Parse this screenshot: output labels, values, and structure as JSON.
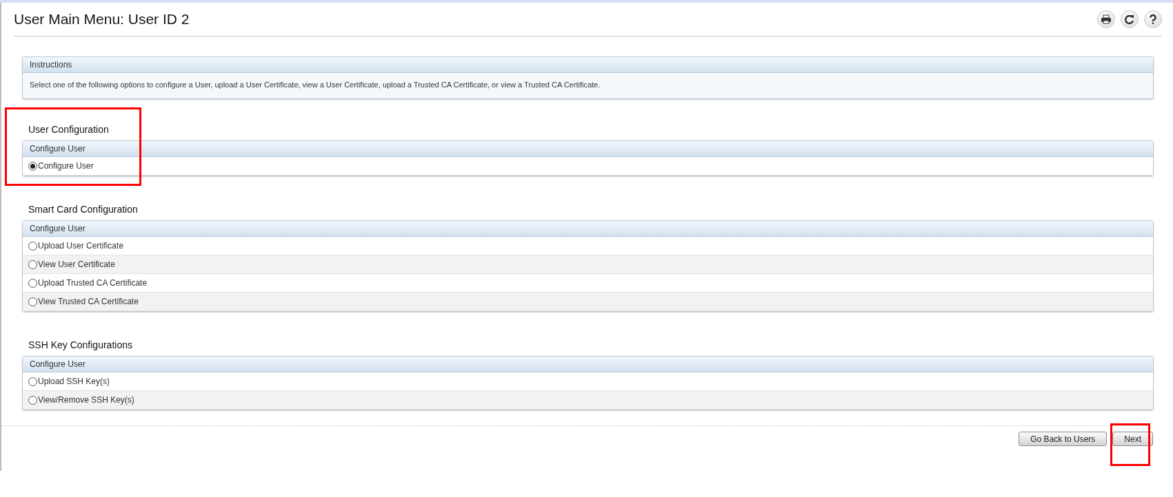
{
  "page": {
    "title": "User Main Menu: User ID 2"
  },
  "toolbar": [
    {
      "kind": "print"
    },
    {
      "kind": "refresh"
    },
    {
      "kind": "help"
    }
  ],
  "instructions": {
    "header": "Instructions",
    "text": "Select one of the following options to configure a User, upload a User Certificate, view a User Certificate, upload a Trusted CA Certificate, or view a Trusted CA Certificate."
  },
  "sections": [
    {
      "heading": "User Configuration",
      "table_header": "Configure User",
      "highlighted": true,
      "options": [
        {
          "label": "Configure User",
          "selected": true
        }
      ]
    },
    {
      "heading": "Smart Card Configuration",
      "table_header": "Configure User",
      "highlighted": false,
      "options": [
        {
          "label": "Upload User Certificate",
          "selected": false
        },
        {
          "label": "View User Certificate",
          "selected": false
        },
        {
          "label": "Upload Trusted CA Certificate",
          "selected": false
        },
        {
          "label": "View Trusted CA Certificate",
          "selected": false
        }
      ]
    },
    {
      "heading": "SSH Key Configurations",
      "table_header": "Configure User",
      "highlighted": false,
      "options": [
        {
          "label": "Upload SSH Key(s)",
          "selected": false
        },
        {
          "label": "View/Remove SSH Key(s)",
          "selected": false
        }
      ]
    }
  ],
  "buttons": [
    {
      "label": "Go Back to Users",
      "highlighted": false
    },
    {
      "label": "Next",
      "highlighted": true
    }
  ]
}
